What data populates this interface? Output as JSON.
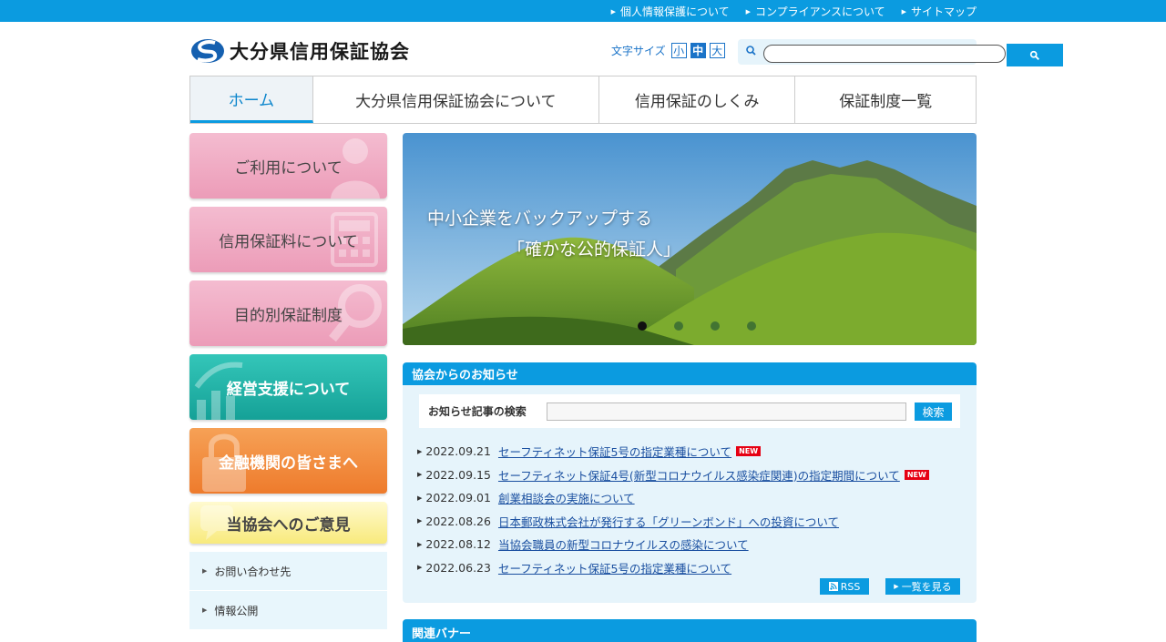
{
  "top_links": [
    {
      "label": "個人情報保護について"
    },
    {
      "label": "コンプライアンスについて"
    },
    {
      "label": "サイトマップ"
    }
  ],
  "logo": {
    "name": "大分県信用保証協会",
    "icon": "logo-mark"
  },
  "font_size": {
    "label": "文字サイズ",
    "small": "小",
    "medium": "中",
    "large": "大",
    "selected": "中"
  },
  "search": {
    "value": "",
    "icon": "search-icon"
  },
  "nav": {
    "home": "ホーム",
    "about": "大分県信用保証協会について",
    "mechanism": "信用保証のしくみ",
    "list": "保証制度一覧"
  },
  "side_buttons": [
    {
      "label": "ご利用について"
    },
    {
      "label": "信用保証料について"
    },
    {
      "label": "目的別保証制度"
    },
    {
      "label": "経営支援について"
    },
    {
      "label": "金融機関の皆さまへ"
    },
    {
      "label": "当協会へのご意見"
    }
  ],
  "side_links": [
    {
      "label": "お問い合わせ先"
    },
    {
      "label": "情報公開"
    }
  ],
  "hero": {
    "line1": "中小企業をバックアップする",
    "line2": "「確かな公的保証人」",
    "slide_count": 4,
    "active_slide": 1
  },
  "news": {
    "heading": "協会からのお知らせ",
    "search_label": "お知らせ記事の検索",
    "search_button": "検索",
    "items": [
      {
        "date": "2022.09.21",
        "title": "セーフティネット保証5号の指定業種について",
        "badge": "NEW"
      },
      {
        "date": "2022.09.15",
        "title": "セーフティネット保証4号(新型コロナウイルス感染症関連)の指定期間について",
        "badge": "NEW"
      },
      {
        "date": "2022.09.01",
        "title": "創業相談会の実施について",
        "badge": ""
      },
      {
        "date": "2022.08.26",
        "title": "日本郵政株式会社が発行する「グリーンボンド」への投資について",
        "badge": ""
      },
      {
        "date": "2022.08.12",
        "title": "当協会職員の新型コロナウイルスの感染について",
        "badge": ""
      },
      {
        "date": "2022.06.23",
        "title": "セーフティネット保証5号の指定業種について",
        "badge": ""
      }
    ],
    "rss": "RSS",
    "more": "一覧を見る"
  },
  "banner": {
    "heading": "関連バナー"
  },
  "colors": {
    "accent": "#0b9be0",
    "link": "#1a4fa0",
    "new_badge": "#e60012"
  }
}
